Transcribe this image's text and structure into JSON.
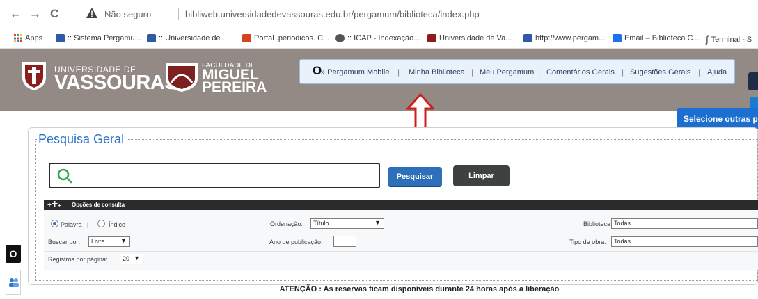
{
  "browser": {
    "back": "←",
    "forward": "→",
    "reload": "C",
    "not_secure": "Não seguro",
    "url": "bibliweb.universidadedevassouras.edu.br/pergamum/biblioteca/index.php",
    "bookmarks": [
      {
        "label": "Apps",
        "color": "#e53935"
      },
      {
        "label": ":: Sistema Pergamu...",
        "color": "#2f5aa8"
      },
      {
        "label": ":: Universidade de...",
        "color": "#2f5aa8"
      },
      {
        "label": "Portal .periodicos. C...",
        "color": "#d8431c"
      },
      {
        "label": ":: ICAP - Indexação...",
        "color": "#555555"
      },
      {
        "label": "Universidade de Va...",
        "color": "#8b1d1d"
      },
      {
        "label": "http://www.pergam...",
        "color": "#2f5aa8"
      },
      {
        "label": "Email – Biblioteca C...",
        "color": "#1a73e8"
      },
      {
        "label": "Terminal - S",
        "color": "#333333"
      }
    ]
  },
  "header": {
    "uv_small": "UNIVERSIDADE DE",
    "uv_big": "VASSOURAS",
    "fmp_small": "FACULDADE DE",
    "fmp_line1": "MIGUEL",
    "fmp_line2": "PEREIRA",
    "nav": {
      "mobile": "» Pergamum Mobile",
      "minha": "Minha Biblioteca",
      "meu": "Meu Pergamum",
      "comentarios": "Comentários Gerais",
      "sugestoes": "Sugestões Gerais",
      "ajuda": "Ajuda",
      "separator": "|",
      "o_mark": "O"
    },
    "brand_color": "#948a85"
  },
  "search": {
    "title": "Pesquisa Geral",
    "select_other": "Selecione outras p",
    "query": "",
    "btn_search": "Pesquisar",
    "btn_clear": "Limpar"
  },
  "options": {
    "title": "Opções de consulta",
    "plus": "+",
    "radio_palavra": "Palavra",
    "radio_pipe": "|",
    "radio_indice": "Índice",
    "ordenacao_label": "Ordenação:",
    "ordenacao_value": "Título",
    "biblioteca_label": "Biblioteca:",
    "biblioteca_value": "Todas",
    "buscar_label": "Buscar por:",
    "buscar_value": "Livre",
    "ano_label": "Ano de publicação:",
    "ano_value": "",
    "tipo_label": "Tipo de obra:",
    "tipo_value": "Todas",
    "registros_label": "Registros por página:",
    "registros_value": "20"
  },
  "side": {
    "o_label": "O"
  },
  "footer": {
    "attention": "ATENÇÃO : As reservas ficam disponíveis durante 24 horas após a liberação"
  }
}
